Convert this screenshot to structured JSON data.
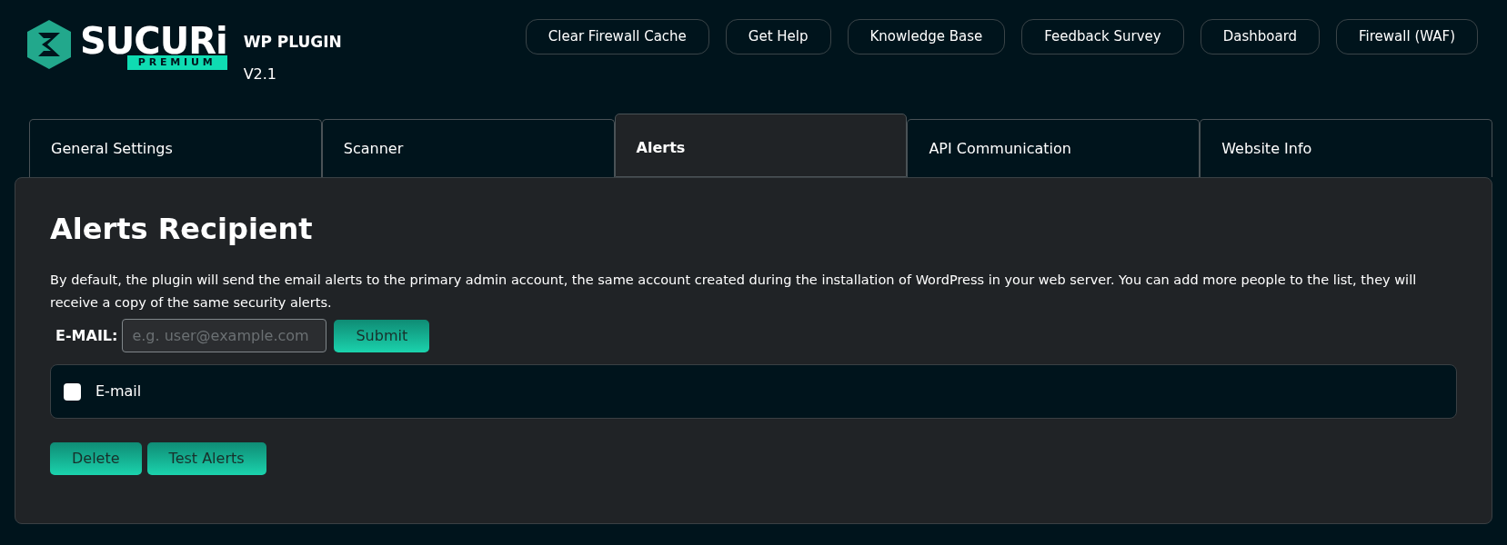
{
  "header": {
    "logo": {
      "name": "SUCURi",
      "badge": "PREMIUM"
    },
    "product": "WP PLUGIN",
    "version": "V2.1",
    "links": [
      "Clear Firewall Cache",
      "Get Help",
      "Knowledge Base",
      "Feedback Survey",
      "Dashboard",
      "Firewall (WAF)"
    ]
  },
  "tabs": [
    {
      "label": "General Settings",
      "selected": false
    },
    {
      "label": "Scanner",
      "selected": false
    },
    {
      "label": "Alerts",
      "selected": true
    },
    {
      "label": "API Communication",
      "selected": false
    },
    {
      "label": "Website Info",
      "selected": false
    }
  ],
  "panel": {
    "title": "Alerts Recipient",
    "description": "By default, the plugin will send the email alerts to the primary admin account, the same account created during the installation of WordPress in your web server. You can add more people to the list, they will receive a copy of the same security alerts.",
    "email_label": "E-MAIL:",
    "email_field": {
      "placeholder": "e.g. user@example.com"
    },
    "submit": "Submit",
    "list": [
      {
        "label": "E-mail",
        "checked": false
      }
    ],
    "actions": [
      "Delete",
      "Test Alerts"
    ]
  }
}
